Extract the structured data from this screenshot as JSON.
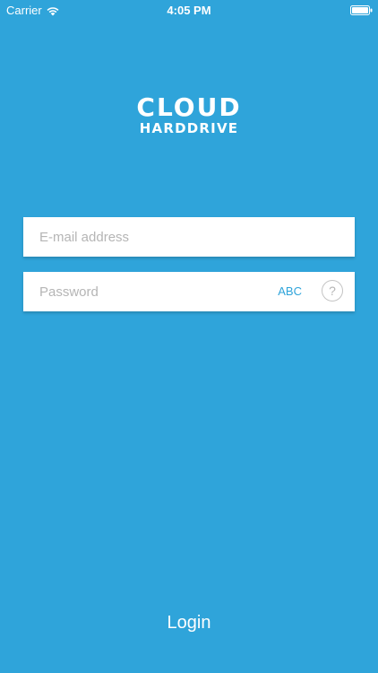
{
  "status_bar": {
    "carrier": "Carrier",
    "time": "4:05 PM",
    "icons": [
      "wifi-icon",
      "battery-icon"
    ]
  },
  "logo": {
    "line1": "CLOUD",
    "line2": "HARDDRIVE"
  },
  "login_form": {
    "email": {
      "placeholder": "E-mail address",
      "value": ""
    },
    "password": {
      "placeholder": "Password",
      "value": "",
      "toggle_label": "ABC",
      "help_label": "?"
    },
    "login_label": "Login"
  },
  "colors": {
    "background": "#2fa4da",
    "accent": "#2fa4da",
    "field_background": "#ffffff",
    "text_on_background": "#ffffff"
  }
}
